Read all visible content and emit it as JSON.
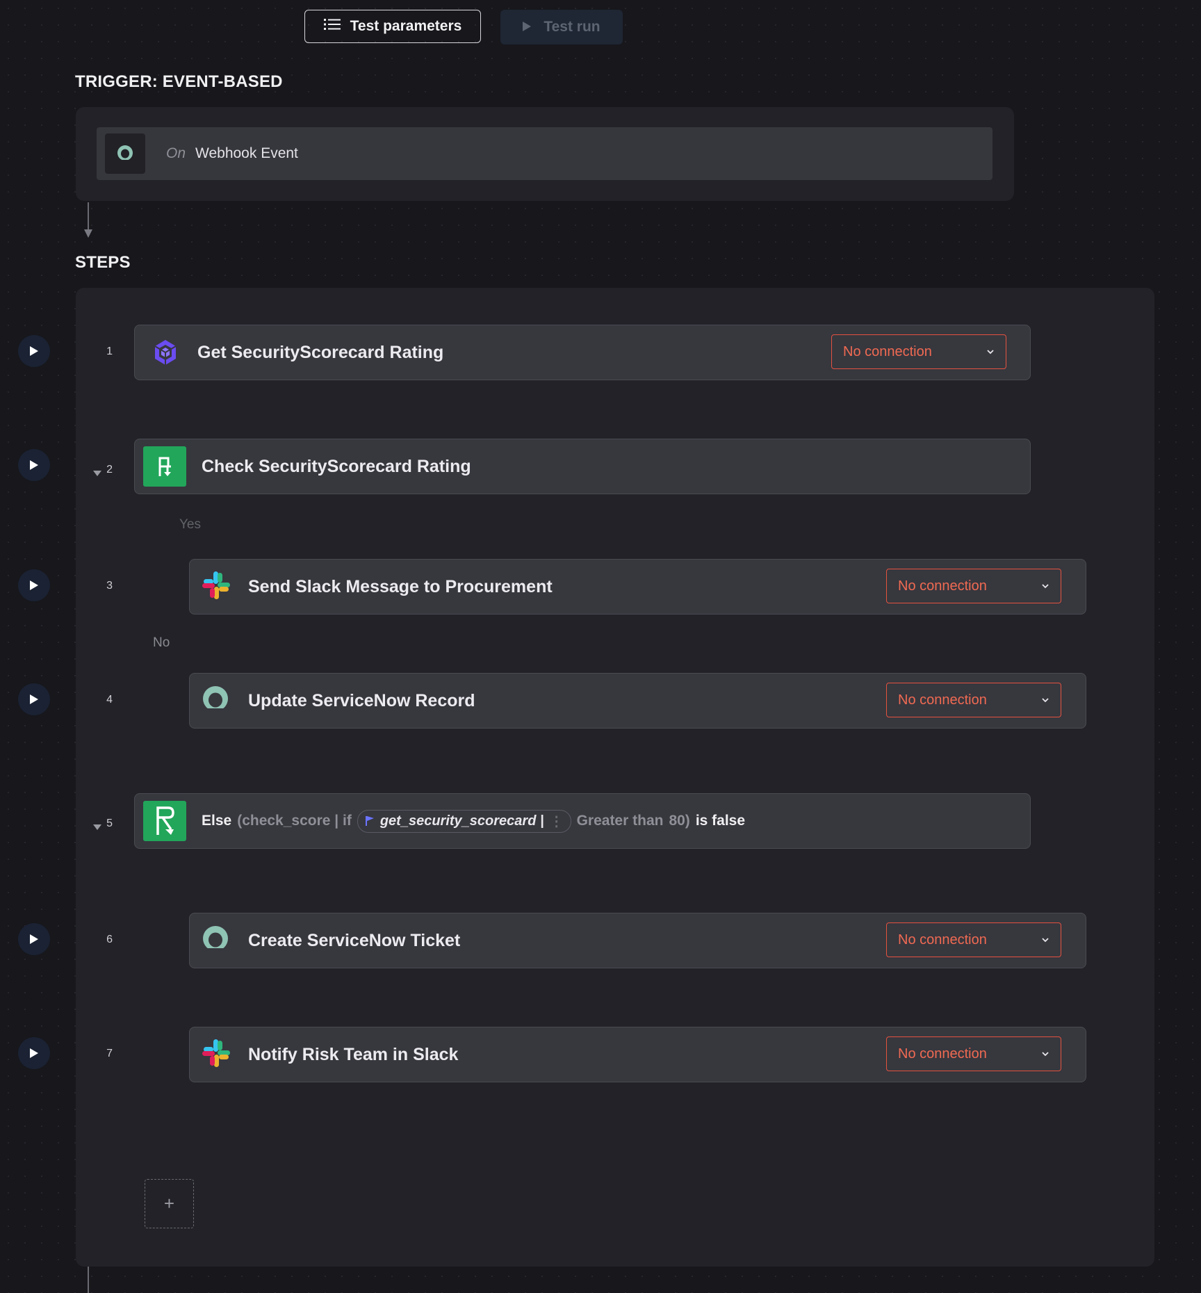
{
  "toolbar": {
    "test_parameters_label": "Test parameters",
    "test_run_label": "Test run"
  },
  "trigger": {
    "section_title": "TRIGGER: EVENT-BASED",
    "on_label": "On",
    "event_label": "Webhook Event",
    "icon": "servicenow-icon"
  },
  "steps": {
    "section_title": "STEPS",
    "branch_yes_label": "Yes",
    "branch_no_label": "No",
    "items": [
      {
        "number": "1",
        "title": "Get SecurityScorecard Rating",
        "icon": "securityscorecard-icon",
        "connection": "No connection"
      },
      {
        "number": "2",
        "title": "Check SecurityScorecard Rating",
        "icon": "branch-icon"
      },
      {
        "number": "3",
        "title": "Send Slack Message to Procurement",
        "icon": "slack-icon",
        "connection": "No connection"
      },
      {
        "number": "4",
        "title": "Update ServiceNow Record",
        "icon": "servicenow-icon",
        "connection": "No connection"
      },
      {
        "number": "5",
        "else_label": "Else",
        "condition_prefix": "(check_score | if",
        "pill_label": "get_security_scorecard |",
        "operator": "Greater than",
        "value": "80)",
        "suffix": "is false",
        "icon": "branch-icon"
      },
      {
        "number": "6",
        "title": "Create ServiceNow Ticket",
        "icon": "servicenow-icon",
        "connection": "No connection"
      },
      {
        "number": "7",
        "title": "Notify Risk Team in Slack",
        "icon": "slack-icon",
        "connection": "No connection"
      }
    ],
    "add_label": "+"
  },
  "colors": {
    "background": "#17171c",
    "panel": "#222228",
    "card": "#37373e",
    "error": "#e5533f",
    "branch_green": "#22a65a",
    "play_bg": "#1a2233"
  }
}
